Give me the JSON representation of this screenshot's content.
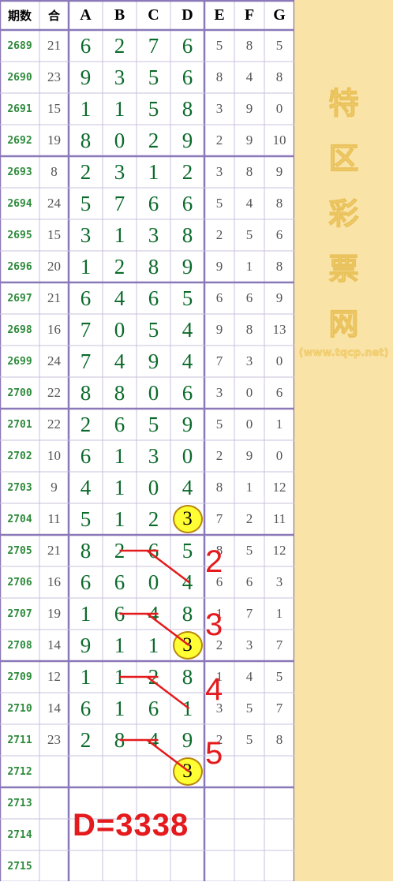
{
  "headers": {
    "period": "期数",
    "sum": "合",
    "cols": [
      "A",
      "B",
      "C",
      "D",
      "E",
      "F",
      "G"
    ]
  },
  "rows": [
    {
      "period": "2689",
      "sum": "21",
      "digits": [
        "6",
        "2",
        "7",
        "6"
      ],
      "extra": [
        "5",
        "8",
        "5"
      ]
    },
    {
      "period": "2690",
      "sum": "23",
      "digits": [
        "9",
        "3",
        "5",
        "6"
      ],
      "extra": [
        "8",
        "4",
        "8"
      ]
    },
    {
      "period": "2691",
      "sum": "15",
      "digits": [
        "1",
        "1",
        "5",
        "8"
      ],
      "extra": [
        "3",
        "9",
        "0"
      ]
    },
    {
      "period": "2692",
      "sum": "19",
      "digits": [
        "8",
        "0",
        "2",
        "9"
      ],
      "extra": [
        "2",
        "9",
        "10"
      ]
    },
    {
      "period": "2693",
      "sum": "8",
      "digits": [
        "2",
        "3",
        "1",
        "2"
      ],
      "extra": [
        "3",
        "8",
        "9"
      ]
    },
    {
      "period": "2694",
      "sum": "24",
      "digits": [
        "5",
        "7",
        "6",
        "6"
      ],
      "extra": [
        "5",
        "4",
        "8"
      ]
    },
    {
      "period": "2695",
      "sum": "15",
      "digits": [
        "3",
        "1",
        "3",
        "8"
      ],
      "extra": [
        "2",
        "5",
        "6"
      ]
    },
    {
      "period": "2696",
      "sum": "20",
      "digits": [
        "1",
        "2",
        "8",
        "9"
      ],
      "extra": [
        "9",
        "1",
        "8"
      ]
    },
    {
      "period": "2697",
      "sum": "21",
      "digits": [
        "6",
        "4",
        "6",
        "5"
      ],
      "extra": [
        "6",
        "6",
        "9"
      ]
    },
    {
      "period": "2698",
      "sum": "16",
      "digits": [
        "7",
        "0",
        "5",
        "4"
      ],
      "extra": [
        "9",
        "8",
        "13"
      ]
    },
    {
      "period": "2699",
      "sum": "24",
      "digits": [
        "7",
        "4",
        "9",
        "4"
      ],
      "extra": [
        "7",
        "3",
        "0"
      ]
    },
    {
      "period": "2700",
      "sum": "22",
      "digits": [
        "8",
        "8",
        "0",
        "6"
      ],
      "extra": [
        "3",
        "0",
        "6"
      ]
    },
    {
      "period": "2701",
      "sum": "22",
      "digits": [
        "2",
        "6",
        "5",
        "9"
      ],
      "extra": [
        "5",
        "0",
        "1"
      ]
    },
    {
      "period": "2702",
      "sum": "10",
      "digits": [
        "6",
        "1",
        "3",
        "0"
      ],
      "extra": [
        "2",
        "9",
        "0"
      ]
    },
    {
      "period": "2703",
      "sum": "9",
      "digits": [
        "4",
        "1",
        "0",
        "4"
      ],
      "extra": [
        "8",
        "1",
        "12"
      ]
    },
    {
      "period": "2704",
      "sum": "11",
      "digits": [
        "5",
        "1",
        "2",
        "3"
      ],
      "extra": [
        "7",
        "2",
        "11"
      ]
    },
    {
      "period": "2705",
      "sum": "21",
      "digits": [
        "8",
        "2",
        "6",
        "5"
      ],
      "extra": [
        "8",
        "5",
        "12"
      ]
    },
    {
      "period": "2706",
      "sum": "16",
      "digits": [
        "6",
        "6",
        "0",
        "4"
      ],
      "extra": [
        "6",
        "6",
        "3"
      ]
    },
    {
      "period": "2707",
      "sum": "19",
      "digits": [
        "1",
        "6",
        "4",
        "8"
      ],
      "extra": [
        "1",
        "7",
        "1"
      ]
    },
    {
      "period": "2708",
      "sum": "14",
      "digits": [
        "9",
        "1",
        "1",
        "3"
      ],
      "extra": [
        "2",
        "3",
        "7"
      ]
    },
    {
      "period": "2709",
      "sum": "12",
      "digits": [
        "1",
        "1",
        "2",
        "8"
      ],
      "extra": [
        "1",
        "4",
        "5"
      ]
    },
    {
      "period": "2710",
      "sum": "14",
      "digits": [
        "6",
        "1",
        "6",
        "1"
      ],
      "extra": [
        "3",
        "5",
        "7"
      ]
    },
    {
      "period": "2711",
      "sum": "23",
      "digits": [
        "2",
        "8",
        "4",
        "9"
      ],
      "extra": [
        "2",
        "5",
        "8"
      ]
    },
    {
      "period": "2712",
      "sum": "",
      "digits": [
        "",
        "",
        "",
        "3"
      ],
      "extra": [
        "",
        "",
        ""
      ]
    },
    {
      "period": "2713",
      "sum": "",
      "digits": [
        "",
        "",
        "",
        ""
      ],
      "extra": [
        "",
        "",
        ""
      ]
    },
    {
      "period": "2714",
      "sum": "",
      "digits": [
        "",
        "",
        "",
        ""
      ],
      "extra": [
        "",
        "",
        ""
      ]
    },
    {
      "period": "2715",
      "sum": "",
      "digits": [
        "",
        "",
        "",
        ""
      ],
      "extra": [
        "",
        "",
        ""
      ]
    }
  ],
  "highlighted_rows": [
    "2704",
    "2708",
    "2712"
  ],
  "annotations": [
    "2",
    "3",
    "4",
    "5"
  ],
  "formula": "D=3338",
  "watermark": {
    "chars": [
      "特",
      "区",
      "彩",
      "票",
      "网"
    ],
    "url": "(www.tqcp.net)"
  },
  "colors": {
    "grid_border": "#8a78b8",
    "digit_green": "#0b6a2a",
    "period_green": "#2e8b3c",
    "highlight": "#ffff33",
    "annotation_red": "#e41a1c",
    "sidebar": "#fae3a6"
  }
}
